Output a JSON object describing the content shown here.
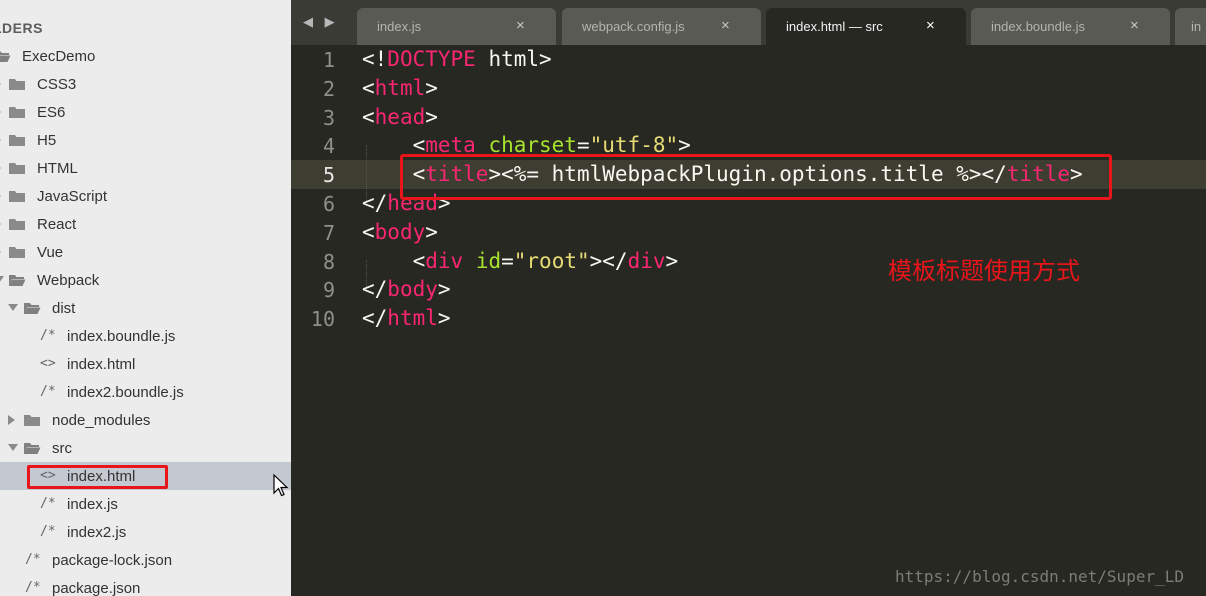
{
  "sidebar": {
    "header": "LDERS",
    "items": [
      {
        "label": "ExecDemo",
        "kind": "folder-open",
        "depth": 0
      },
      {
        "label": "CSS3",
        "kind": "folder",
        "depth": 1
      },
      {
        "label": "ES6",
        "kind": "folder",
        "depth": 1
      },
      {
        "label": "H5",
        "kind": "folder",
        "depth": 1
      },
      {
        "label": "HTML",
        "kind": "folder",
        "depth": 1
      },
      {
        "label": "JavaScript",
        "kind": "folder",
        "depth": 1
      },
      {
        "label": "React",
        "kind": "folder",
        "depth": 1
      },
      {
        "label": "Vue",
        "kind": "folder",
        "depth": 1
      },
      {
        "label": "Webpack",
        "kind": "folder-open",
        "depth": 1
      },
      {
        "label": "dist",
        "kind": "folder-open",
        "depth": 2
      },
      {
        "label": "index.boundle.js",
        "kind": "js-file",
        "icon": "/*",
        "depth": 3
      },
      {
        "label": "index.html",
        "kind": "html-file",
        "icon": "<>",
        "depth": 3
      },
      {
        "label": "index2.boundle.js",
        "kind": "js-file",
        "icon": "/*",
        "depth": 3
      },
      {
        "label": "node_modules",
        "kind": "folder",
        "depth": 2
      },
      {
        "label": "src",
        "kind": "folder-open",
        "depth": 2
      },
      {
        "label": "index.html",
        "kind": "html-file",
        "icon": "<>",
        "depth": 3,
        "selected": true
      },
      {
        "label": "index.js",
        "kind": "js-file",
        "icon": "/*",
        "depth": 3
      },
      {
        "label": "index2.js",
        "kind": "js-file",
        "icon": "/*",
        "depth": 3
      },
      {
        "label": "package-lock.json",
        "kind": "json-file",
        "icon": "/*",
        "depth": 2
      },
      {
        "label": "package.json",
        "kind": "json-file",
        "icon": "/*",
        "depth": 2
      }
    ]
  },
  "tabbar": {
    "nav_arrows": "◀ ▶",
    "tabs": [
      {
        "label": "index.js",
        "active": false,
        "close": "×"
      },
      {
        "label": "webpack.config.js",
        "active": false,
        "close": "×"
      },
      {
        "label": "index.html — src",
        "active": true,
        "close": "×"
      },
      {
        "label": "index.boundle.js",
        "active": false,
        "close": "×"
      },
      {
        "label": "in",
        "active": false,
        "close": ""
      }
    ]
  },
  "editor": {
    "active_line": 5,
    "lines": [
      {
        "num": "1",
        "tokens": [
          {
            "t": "<!",
            "c": "punc"
          },
          {
            "t": "DOCTYPE",
            "c": "tag"
          },
          {
            "t": " html>",
            "c": "punc"
          }
        ]
      },
      {
        "num": "2",
        "tokens": [
          {
            "t": "<",
            "c": "punc"
          },
          {
            "t": "html",
            "c": "tag"
          },
          {
            "t": ">",
            "c": "punc"
          }
        ]
      },
      {
        "num": "3",
        "tokens": [
          {
            "t": "<",
            "c": "punc"
          },
          {
            "t": "head",
            "c": "tag"
          },
          {
            "t": ">",
            "c": "punc"
          }
        ]
      },
      {
        "num": "4",
        "tokens": [
          {
            "t": "    <",
            "c": "punc"
          },
          {
            "t": "meta",
            "c": "tag"
          },
          {
            "t": " ",
            "c": "punc"
          },
          {
            "t": "charset",
            "c": "attr"
          },
          {
            "t": "=",
            "c": "punc"
          },
          {
            "t": "\"utf-8\"",
            "c": "str"
          },
          {
            "t": ">",
            "c": "punc"
          }
        ]
      },
      {
        "num": "5",
        "tokens": [
          {
            "t": "    <",
            "c": "punc"
          },
          {
            "t": "title",
            "c": "tag"
          },
          {
            "t": "><%= htmlWebpackPlugin.options.title %></",
            "c": "punc"
          },
          {
            "t": "title",
            "c": "tag"
          },
          {
            "t": ">",
            "c": "punc"
          }
        ]
      },
      {
        "num": "6",
        "tokens": [
          {
            "t": "</",
            "c": "punc"
          },
          {
            "t": "head",
            "c": "tag"
          },
          {
            "t": ">",
            "c": "punc"
          }
        ]
      },
      {
        "num": "7",
        "tokens": [
          {
            "t": "<",
            "c": "punc"
          },
          {
            "t": "body",
            "c": "tag"
          },
          {
            "t": ">",
            "c": "punc"
          }
        ]
      },
      {
        "num": "8",
        "tokens": [
          {
            "t": "    <",
            "c": "punc"
          },
          {
            "t": "div",
            "c": "tag"
          },
          {
            "t": " ",
            "c": "punc"
          },
          {
            "t": "id",
            "c": "attr"
          },
          {
            "t": "=",
            "c": "punc"
          },
          {
            "t": "\"root\"",
            "c": "str"
          },
          {
            "t": "></",
            "c": "punc"
          },
          {
            "t": "div",
            "c": "tag"
          },
          {
            "t": ">",
            "c": "punc"
          }
        ]
      },
      {
        "num": "9",
        "tokens": [
          {
            "t": "</",
            "c": "punc"
          },
          {
            "t": "body",
            "c": "tag"
          },
          {
            "t": ">",
            "c": "punc"
          }
        ]
      },
      {
        "num": "10",
        "tokens": [
          {
            "t": "</",
            "c": "punc"
          },
          {
            "t": "html",
            "c": "tag"
          },
          {
            "t": ">",
            "c": "punc"
          }
        ]
      }
    ],
    "annotation": "模板标题使用方式",
    "watermark": "https://blog.csdn.net/Super_LD"
  },
  "colors": {
    "editor_bg": "#272822",
    "tag": "#f92672",
    "attribute": "#a6e22e",
    "string": "#e6db74",
    "highlight_box": "#e8151b"
  }
}
